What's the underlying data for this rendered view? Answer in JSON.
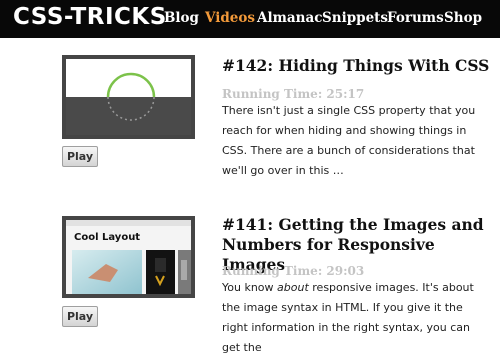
{
  "header": {
    "logo": "CSS-TRICKS",
    "nav": [
      {
        "label": "Blog"
      },
      {
        "label": "Videos",
        "active": true
      },
      {
        "label": "Almanac"
      },
      {
        "label": "Snippets"
      },
      {
        "label": "Forums"
      },
      {
        "label": "Shop"
      }
    ],
    "colors": {
      "background": "#080808",
      "text": "#ffffff",
      "active": "#f39a3a"
    }
  },
  "videos": [
    {
      "title": "#142: Hiding Things With CSS",
      "runtime": "Running Time: 25:17",
      "play_label": "Play",
      "description": "There isn't just a single CSS property that you reach for when hiding and showing things in CSS. There are a bunch of considerations that we'll go over in this …"
    },
    {
      "title": "#141: Getting the Images and Numbers for Responsive Images",
      "runtime": "Running Time: 29:03",
      "play_label": "Play",
      "description_before": "You know ",
      "description_em": "about",
      "description_after": " responsive images. It's about the image syntax in HTML. If you give it the right information in the right syntax, you can get the",
      "thumbnail_heading": "Cool Layout"
    }
  ],
  "colors": {
    "runtime": "#c4c4c4",
    "thumb_border": "#454545",
    "accent_ring": "#7cc24a"
  }
}
